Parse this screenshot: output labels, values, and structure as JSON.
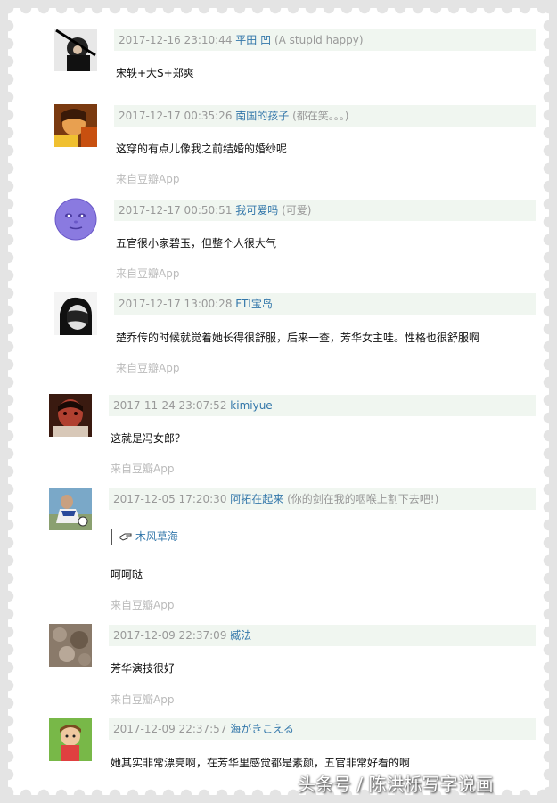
{
  "comments": [
    {
      "date": "2017-12-16 23:10:44",
      "author": "平田 凹",
      "note": "(A stupid happy)",
      "text": "宋轶+大S+郑爽",
      "source": "",
      "quote": ""
    },
    {
      "date": "2017-12-17 00:35:26",
      "author": "南国的孩子",
      "note": "(都在笑。。。)",
      "text": "这穿的有点儿像我之前结婚的婚纱呢",
      "source": "来自豆瓣App",
      "quote": ""
    },
    {
      "date": "2017-12-17 00:50:51",
      "author": "我可爱吗",
      "note": "(可爱)",
      "text": "五官很小家碧玉，但整个人很大气",
      "source": "来自豆瓣App",
      "quote": ""
    },
    {
      "date": "2017-12-17 13:00:28",
      "author": "FTI宝岛",
      "note": "",
      "text": "楚乔传的时候就觉着她长得很舒服，后来一查，芳华女主哇。性格也很舒服啊",
      "source": "来自豆瓣App",
      "quote": ""
    },
    {
      "date": "2017-11-24 23:07:52",
      "author": "kimiyue",
      "note": "",
      "text": "这就是冯女郎？",
      "source": "来自豆瓣App",
      "quote": ""
    },
    {
      "date": "2017-12-05 17:20:30",
      "author": "阿拓在起来",
      "note": "(你的剑在我的咽喉上割下去吧!)",
      "text": "呵呵哒",
      "source": "来自豆瓣App",
      "quote": "木风草海"
    },
    {
      "date": "2017-12-09 22:37:09",
      "author": "臧法",
      "note": "",
      "text": "芳华演技很好",
      "source": "来自豆瓣App",
      "quote": ""
    },
    {
      "date": "2017-12-09 22:37:57",
      "author": "海がきこえる",
      "note": "",
      "text": "她其实非常漂亮啊，在芳华里感觉都是素颜，五官非常好看的啊",
      "source": "",
      "quote": ""
    }
  ],
  "watermark": "头条号 / 陈洪栎写字说画"
}
